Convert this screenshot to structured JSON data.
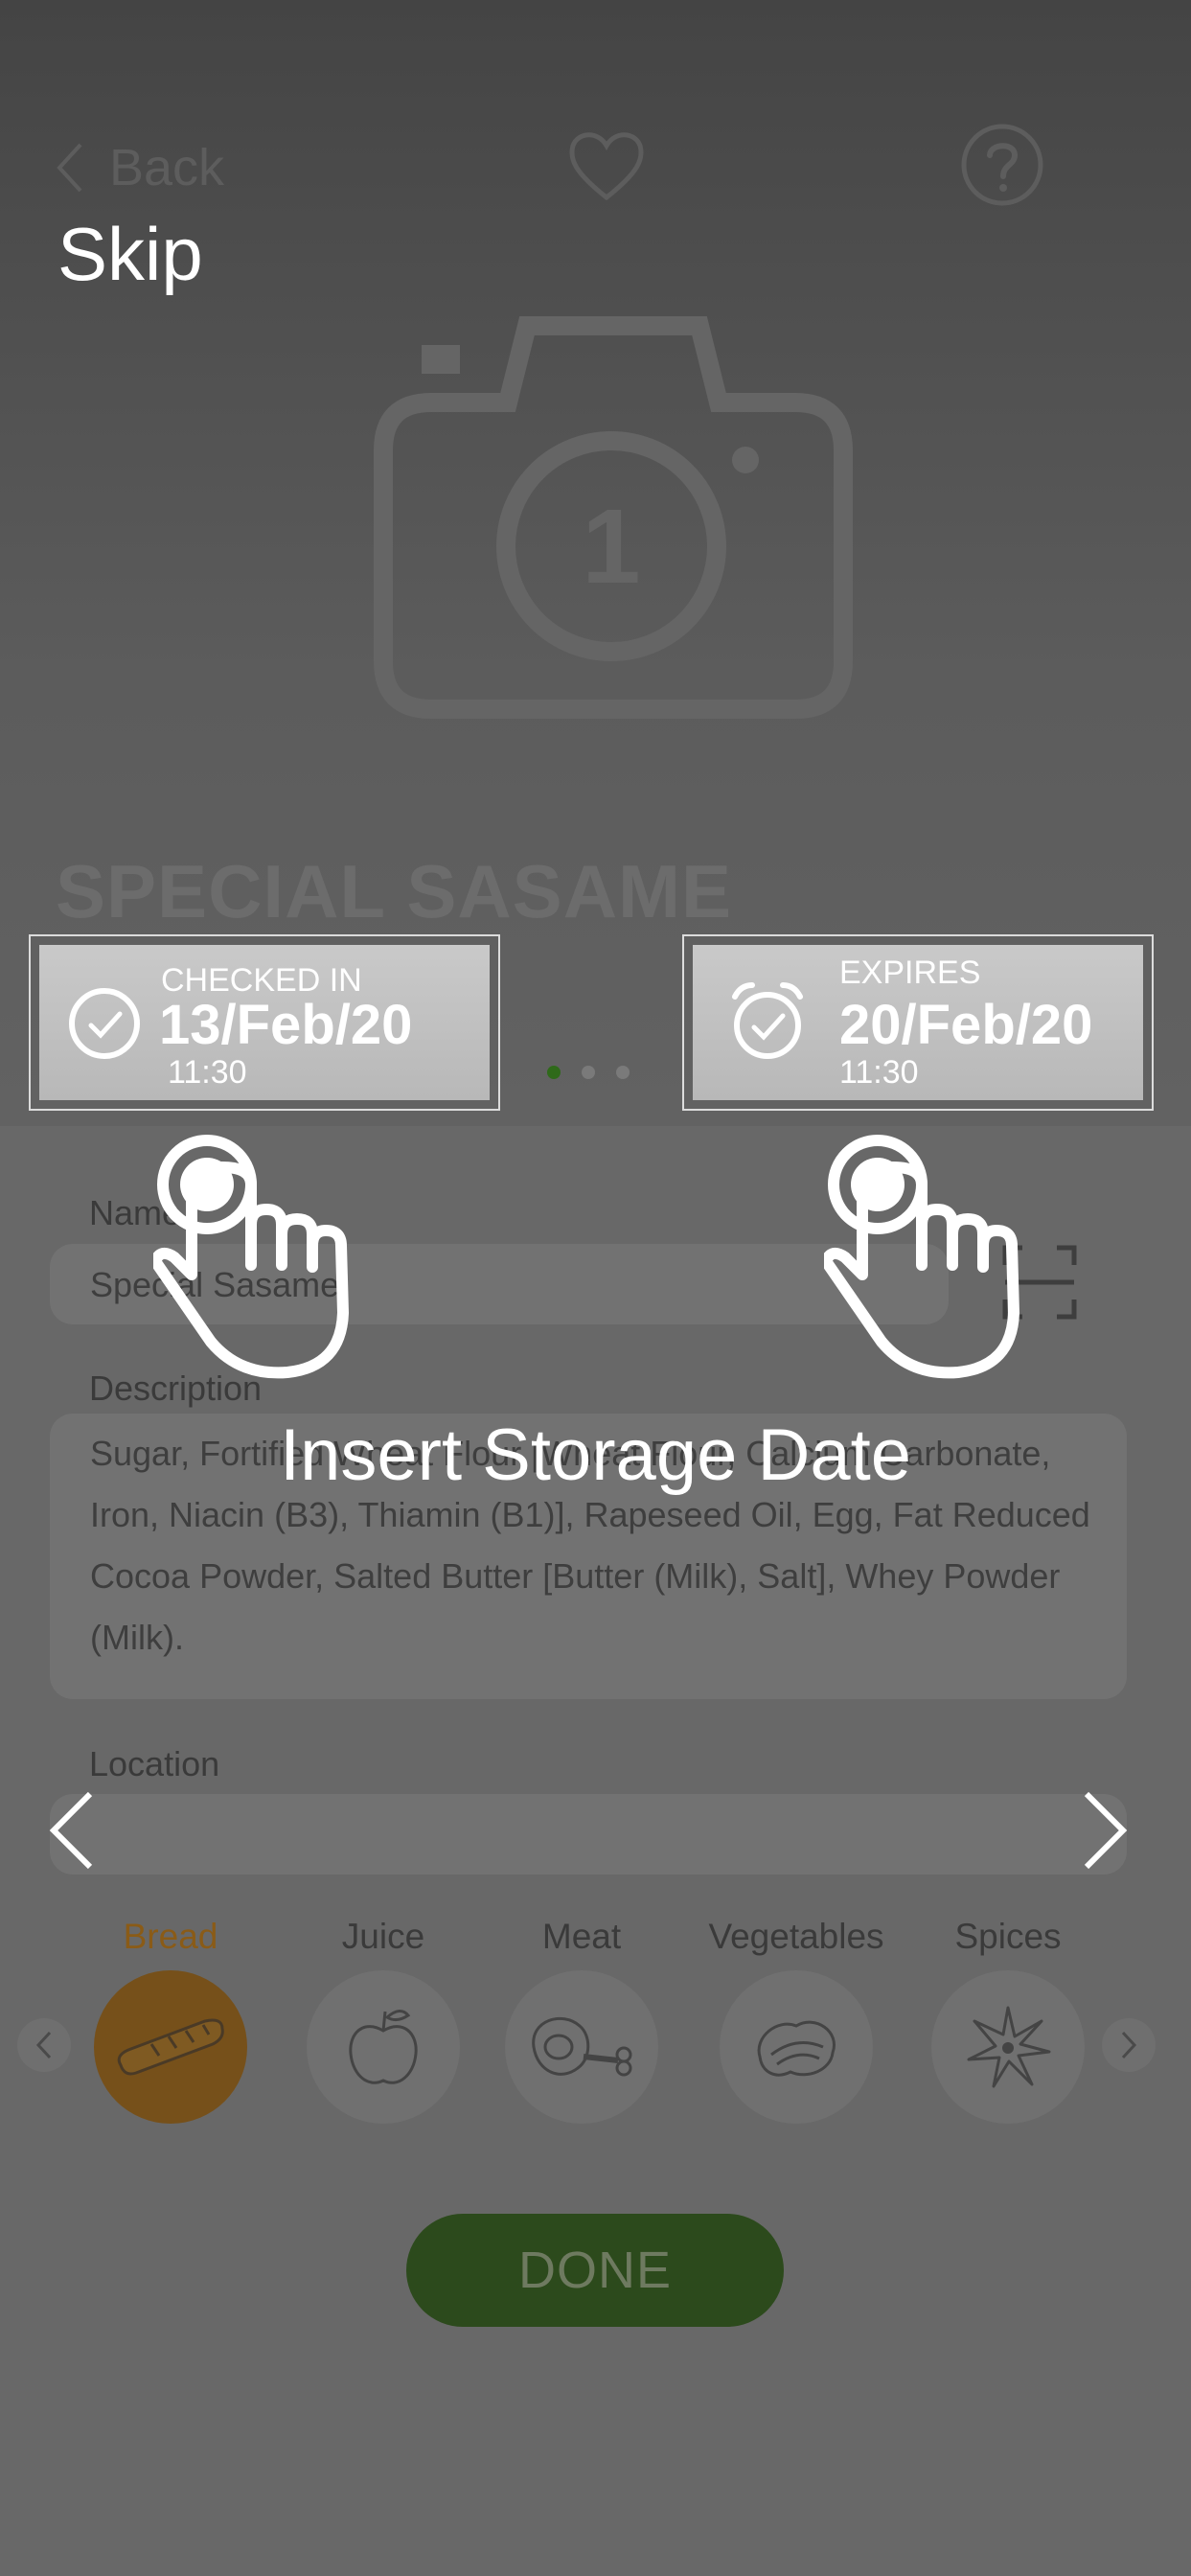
{
  "overlay": {
    "skip_label": "Skip",
    "headline": "Insert Storage Date",
    "checked_in": {
      "label": "CHECKED IN",
      "date": "13/Feb/20",
      "time": "11:30"
    },
    "expires": {
      "label": "EXPIRES",
      "date": "20/Feb/20",
      "time": "11:30"
    },
    "hand_icon": "tap-hand-icon",
    "prev_icon": "chevron-left-icon",
    "next_icon": "chevron-right-icon"
  },
  "header": {
    "back_label": "Back",
    "favorite_icon": "heart-icon",
    "help_icon": "question-icon"
  },
  "product": {
    "photo_icon": "camera-icon",
    "photo_index": "1",
    "title": "SPECIAL SASAME",
    "pager": {
      "count": 3,
      "active": 0
    }
  },
  "form": {
    "name_label": "Name",
    "name_value": "Special Sasame",
    "description_label": "Description",
    "description_lines": [
      "Sugar, Fortified Wheat Flour [Wheat Flour, Calcium Carbonate,",
      "Iron, Niacin (B3), Thiamin (B1)], Rapeseed Oil, Egg, Fat Reduced",
      "Cocoa Powder, Salted Butter [Butter (Milk), Salt], Whey Powder",
      "(Milk)."
    ],
    "location_label": "Location",
    "location_value": ""
  },
  "categories": {
    "items": [
      {
        "label": "Bread",
        "icon": "bread-icon",
        "selected": true
      },
      {
        "label": "Juice",
        "icon": "apple-icon",
        "selected": false
      },
      {
        "label": "Meat",
        "icon": "meat-icon",
        "selected": false
      },
      {
        "label": "Vegetables",
        "icon": "vegetables-icon",
        "selected": false
      },
      {
        "label": "Spices",
        "icon": "star-anise-icon",
        "selected": false
      }
    ]
  },
  "done_label": "DONE",
  "colors": {
    "accent_green": "#2c4a1c",
    "selected_category": "#76501a",
    "overlay_text": "#ffffff"
  }
}
